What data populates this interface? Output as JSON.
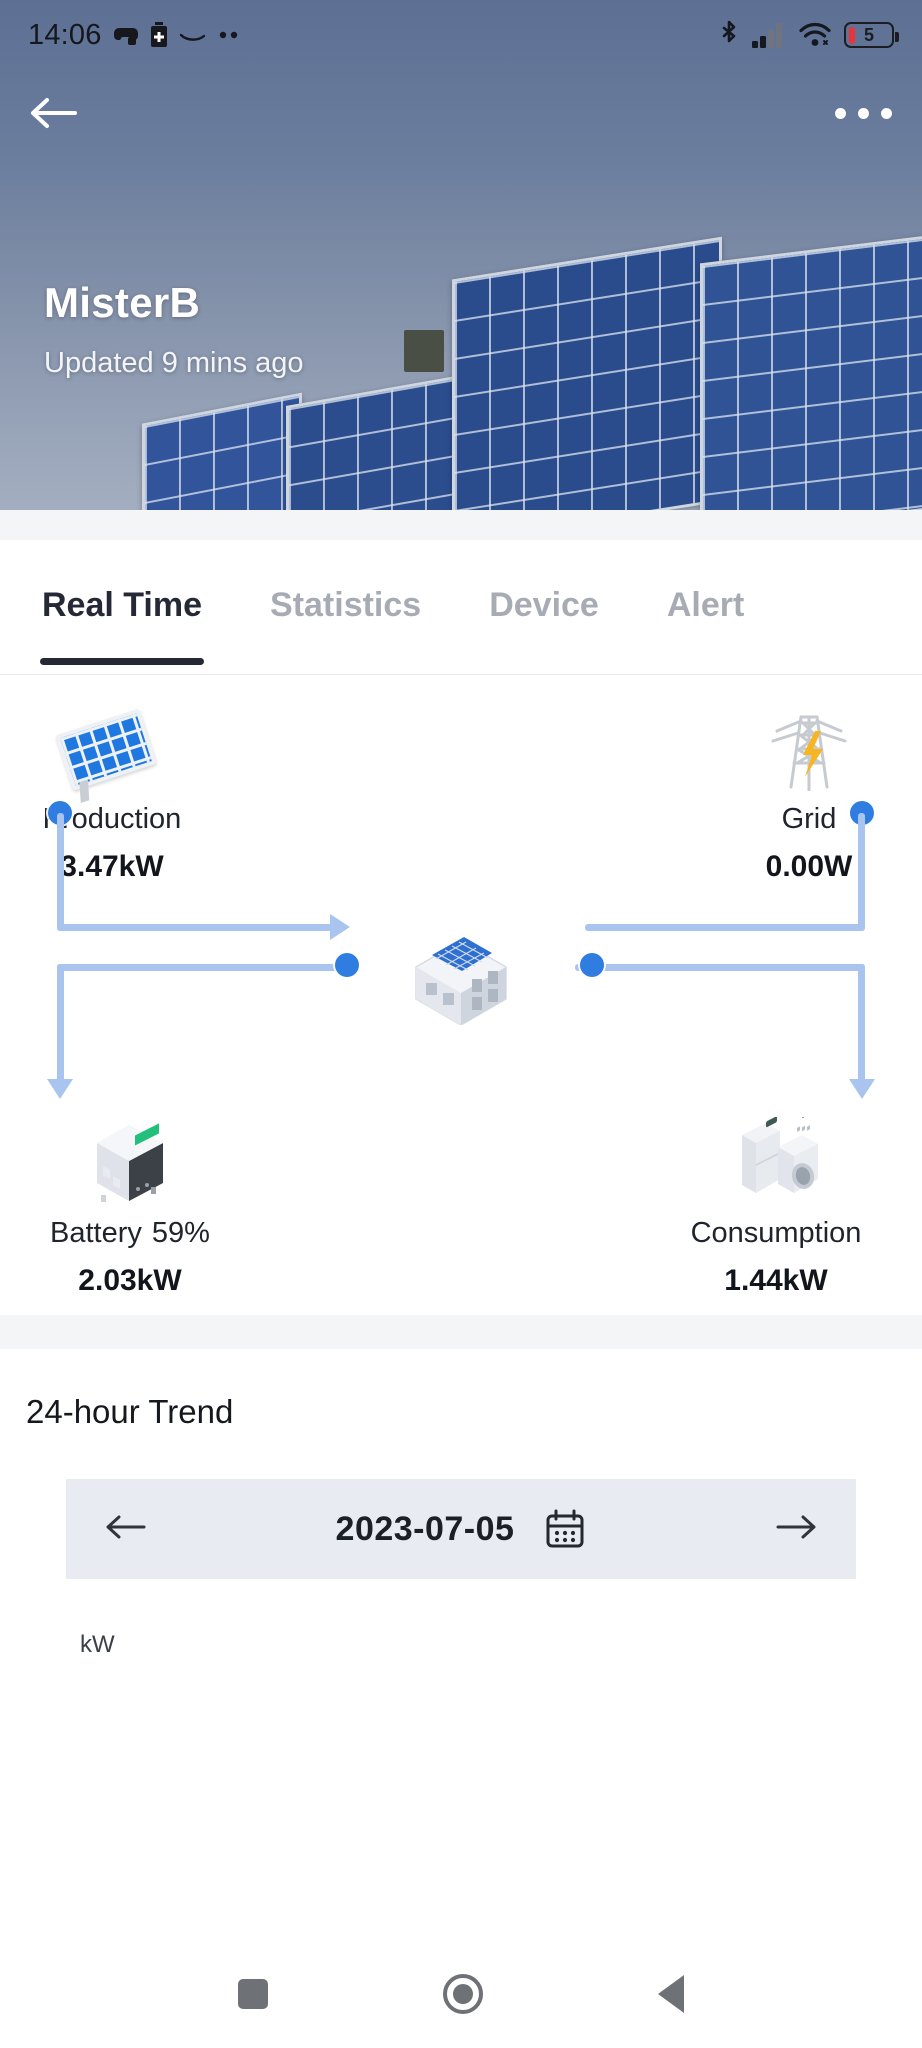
{
  "statusbar": {
    "time": "14:06",
    "left_icons": [
      "game-controller-icon",
      "battery-plus-icon",
      "amazon-icon",
      "more-dots-icon"
    ],
    "right_icons": [
      "bluetooth-icon",
      "cellular-signal-icon",
      "wifi-icon"
    ],
    "battery_level": "5"
  },
  "header": {
    "back_icon": "back-arrow-icon",
    "menu_icon": "overflow-menu-icon",
    "title": "MisterB",
    "subtitle": "Updated 9 mins ago"
  },
  "tabs": [
    {
      "label": "Real Time",
      "active": true
    },
    {
      "label": "Statistics",
      "active": false
    },
    {
      "label": "Device",
      "active": false
    },
    {
      "label": "Alert",
      "active": false
    }
  ],
  "flow": {
    "production": {
      "label": "Production",
      "value": "3.47kW",
      "icon": "solar-panel-icon"
    },
    "grid": {
      "label": "Grid",
      "value": "0.00W",
      "icon": "power-pylon-icon"
    },
    "battery": {
      "label": "Battery",
      "percent": "59%",
      "value": "2.03kW",
      "icon": "battery-cabinet-icon"
    },
    "consumption": {
      "label": "Consumption",
      "value": "1.44kW",
      "icon": "home-appliances-icon"
    },
    "center_icon": "house-icon",
    "line_color": "#a8c4ef",
    "dot_color": "#2f7de1"
  },
  "trend": {
    "title": "24-hour Trend",
    "prev_icon": "arrow-left-icon",
    "next_icon": "arrow-right-icon",
    "date": "2023-07-05",
    "calendar_icon": "calendar-icon",
    "y_axis_unit": "kW"
  },
  "sysnav": {
    "recents_icon": "square-recents-icon",
    "home_icon": "circle-home-icon",
    "back_icon": "triangle-back-icon"
  }
}
